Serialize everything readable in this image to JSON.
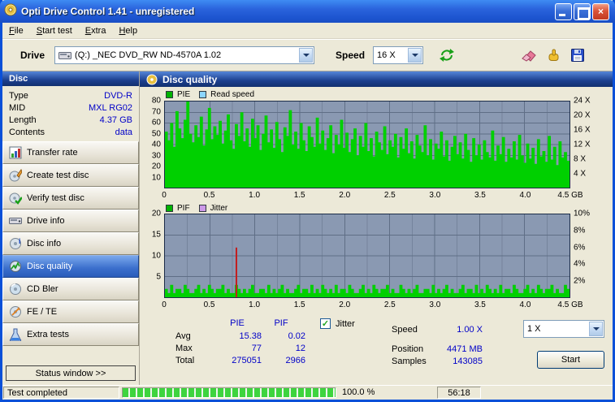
{
  "window": {
    "title": "Opti Drive Control 1.41 - unregistered"
  },
  "menu": {
    "items": [
      {
        "label": "File"
      },
      {
        "label": "Start test"
      },
      {
        "label": "Extra"
      },
      {
        "label": "Help"
      }
    ]
  },
  "toolbar": {
    "drive_label": "Drive",
    "drive_value": "(Q:)  _NEC DVD_RW ND-4570A 1.02",
    "speed_label": "Speed",
    "speed_value": "16 X"
  },
  "sidebar": {
    "disc_header": "Disc",
    "info": [
      {
        "label": "Type",
        "value": "DVD-R"
      },
      {
        "label": "MID",
        "value": "MXL RG02"
      },
      {
        "label": "Length",
        "value": "4.37 GB"
      },
      {
        "label": "Contents",
        "value": "data"
      }
    ],
    "buttons": [
      {
        "label": "Transfer rate"
      },
      {
        "label": "Create test disc"
      },
      {
        "label": "Verify test disc"
      },
      {
        "label": "Drive info"
      },
      {
        "label": "Disc info"
      },
      {
        "label": "Disc quality",
        "selected": true
      },
      {
        "label": "CD Bler"
      },
      {
        "label": "FE / TE"
      },
      {
        "label": "Extra tests"
      }
    ],
    "status_window_label": "Status window >>"
  },
  "main": {
    "header": "Disc quality"
  },
  "stats": {
    "pie_header": "PIE",
    "pif_header": "PIF",
    "jitter_label": "Jitter",
    "jitter_checked": "✓",
    "rows": [
      {
        "label": "Avg",
        "pie": "15.38",
        "pif": "0.02"
      },
      {
        "label": "Max",
        "pie": "77",
        "pif": "12"
      },
      {
        "label": "Total",
        "pie": "275051",
        "pif": "2966"
      }
    ],
    "speed_label": "Speed",
    "speed_value": "1.00 X",
    "position_label": "Position",
    "position_value": "4471 MB",
    "samples_label": "Samples",
    "samples_value": "143085",
    "speed_select_value": "1 X",
    "start_label": "Start"
  },
  "statusbar": {
    "status": "Test completed",
    "percent": "100.0 %",
    "time": "56:18"
  },
  "chart_data": [
    {
      "type": "bar",
      "name": "PIE / Read speed",
      "legend": [
        {
          "label": "PIE",
          "color": "#00b200"
        },
        {
          "label": "Read speed",
          "color": "#8cd6ff"
        }
      ],
      "ylim": [
        0,
        80
      ],
      "xlim_gb": [
        0,
        4.5
      ],
      "v_divs": 18,
      "h_divs": 8,
      "grid_major": "#5f6e86",
      "grid_minor": "#75849c",
      "bar_color": "#00d000",
      "hline": {
        "pos": 0.9583,
        "color": "#8cd6ff"
      },
      "left_ticks": [
        {
          "label": "80",
          "pos": 0
        },
        {
          "label": "70",
          "pos": 0.125
        },
        {
          "label": "60",
          "pos": 0.25
        },
        {
          "label": "50",
          "pos": 0.375
        },
        {
          "label": "40",
          "pos": 0.5
        },
        {
          "label": "30",
          "pos": 0.625
        },
        {
          "label": "20",
          "pos": 0.75
        },
        {
          "label": "10",
          "pos": 0.875
        }
      ],
      "right_ticks": [
        {
          "label": "24 X",
          "pos": 0
        },
        {
          "label": "20 X",
          "pos": 0.1667
        },
        {
          "label": "16 X",
          "pos": 0.3333
        },
        {
          "label": "12 X",
          "pos": 0.5
        },
        {
          "label": "8 X",
          "pos": 0.6667
        },
        {
          "label": "4 X",
          "pos": 0.8333
        }
      ],
      "x_ticks": [
        {
          "label": "0",
          "pos": 0
        },
        {
          "label": "0.5",
          "pos": 0.1111
        },
        {
          "label": "1.0",
          "pos": 0.2222
        },
        {
          "label": "1.5",
          "pos": 0.3333
        },
        {
          "label": "2.0",
          "pos": 0.4444
        },
        {
          "label": "2.5",
          "pos": 0.5556
        },
        {
          "label": "3.0",
          "pos": 0.6667
        },
        {
          "label": "3.5",
          "pos": 0.7778
        },
        {
          "label": "4.0",
          "pos": 0.8889
        },
        {
          "label": "4.5 GB",
          "pos": 1
        }
      ],
      "values": [
        52,
        44,
        60,
        38,
        71,
        55,
        46,
        63,
        80,
        50,
        42,
        58,
        47,
        66,
        39,
        54,
        74,
        45,
        57,
        49,
        62,
        41,
        53,
        68,
        44,
        36,
        59,
        48,
        70,
        43,
        55,
        38,
        64,
        46,
        58,
        35,
        50,
        67,
        42,
        54,
        37,
        61,
        45,
        33,
        56,
        48,
        72,
        40,
        52,
        36,
        60,
        44,
        34,
        57,
        47,
        38,
        65,
        41,
        53,
        35,
        46,
        58,
        32,
        49,
        40,
        63,
        37,
        51,
        33,
        45,
        55,
        30,
        48,
        38,
        60,
        34,
        46,
        29,
        52,
        42,
        35,
        57,
        31,
        44,
        38,
        50,
        28,
        47,
        36,
        55,
        32,
        43,
        27,
        49,
        39,
        33,
        58,
        30,
        45,
        26,
        41,
        36,
        52,
        29,
        44,
        25,
        38,
        48,
        31,
        42,
        27,
        50,
        35,
        24,
        46,
        30,
        40,
        26,
        44,
        33,
        28,
        53,
        25,
        39,
        31,
        47,
        24,
        36,
        28,
        43,
        26,
        49,
        30,
        23,
        41,
        27,
        37,
        22,
        45,
        29,
        34,
        24,
        48,
        26,
        38,
        21,
        43,
        28,
        33,
        25
      ]
    },
    {
      "type": "bar",
      "name": "PIF / Jitter",
      "legend": [
        {
          "label": "PIF",
          "color": "#00b200"
        },
        {
          "label": "Jitter",
          "color": "#cc99e8"
        }
      ],
      "ylim": [
        0,
        20
      ],
      "xlim_gb": [
        0,
        4.5
      ],
      "v_divs": 18,
      "h_divs": 4,
      "grid_major": "#5f6e86",
      "grid_minor": "#75849c",
      "bar_color": "#00d000",
      "spike": {
        "index": 26,
        "value": 12,
        "color": "#c41e1e"
      },
      "left_ticks": [
        {
          "label": "20",
          "pos": 0
        },
        {
          "label": "15",
          "pos": 0.25
        },
        {
          "label": "10",
          "pos": 0.5
        },
        {
          "label": "5",
          "pos": 0.75
        }
      ],
      "right_ticks": [
        {
          "label": "10%",
          "pos": 0
        },
        {
          "label": "8%",
          "pos": 0.2
        },
        {
          "label": "6%",
          "pos": 0.4
        },
        {
          "label": "4%",
          "pos": 0.6
        },
        {
          "label": "2%",
          "pos": 0.8
        }
      ],
      "x_ticks": [
        {
          "label": "0",
          "pos": 0
        },
        {
          "label": "0.5",
          "pos": 0.1111
        },
        {
          "label": "1.0",
          "pos": 0.2222
        },
        {
          "label": "1.5",
          "pos": 0.3333
        },
        {
          "label": "2.0",
          "pos": 0.4444
        },
        {
          "label": "2.5",
          "pos": 0.5556
        },
        {
          "label": "3.0",
          "pos": 0.6667
        },
        {
          "label": "3.5",
          "pos": 0.7778
        },
        {
          "label": "4.0",
          "pos": 0.8889
        },
        {
          "label": "4.5 GB",
          "pos": 1
        }
      ],
      "values": [
        2,
        1,
        3,
        1,
        2,
        2,
        1,
        3,
        2,
        1,
        1,
        2,
        3,
        1,
        2,
        1,
        3,
        2,
        1,
        2,
        2,
        3,
        1,
        2,
        1,
        1,
        3,
        2,
        1,
        2,
        1,
        2,
        3,
        1,
        1,
        2,
        2,
        1,
        3,
        1,
        2,
        1,
        2,
        3,
        1,
        2,
        1,
        1,
        2,
        3,
        1,
        2,
        2,
        1,
        3,
        1,
        2,
        1,
        3,
        2,
        1,
        2,
        1,
        3,
        1,
        2,
        2,
        1,
        3,
        2,
        1,
        1,
        2,
        3,
        1,
        2,
        1,
        3,
        2,
        1,
        2,
        2,
        3,
        1,
        2,
        1,
        1,
        3,
        2,
        1,
        2,
        1,
        2,
        3,
        1,
        1,
        2,
        2,
        1,
        3,
        1,
        2,
        1,
        2,
        3,
        1,
        2,
        1,
        1,
        2,
        3,
        1,
        2,
        2,
        1,
        3,
        1,
        2,
        1,
        3,
        2,
        1,
        2,
        1,
        3,
        1,
        2,
        2,
        1,
        3,
        2,
        1,
        1,
        2,
        3,
        1,
        2,
        1,
        3,
        2,
        1,
        2,
        2,
        3,
        1,
        2,
        1,
        1,
        3,
        2
      ]
    }
  ]
}
